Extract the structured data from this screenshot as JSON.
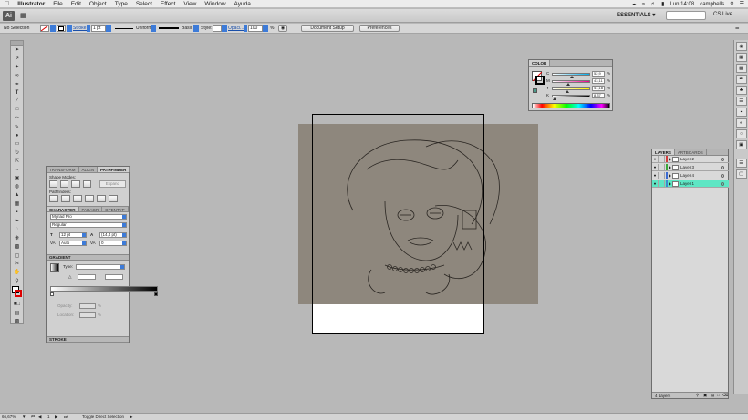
{
  "menubar": {
    "app_name": "Illustrator",
    "menus": [
      "File",
      "Edit",
      "Object",
      "Type",
      "Select",
      "Effect",
      "View",
      "Window",
      "Ayuda"
    ],
    "clock": "Lun 14:08",
    "user": "campbells"
  },
  "appbar": {
    "logo": "Ai",
    "workspace": "ESSENTIALS ▾",
    "cs_live": "CS Live"
  },
  "control": {
    "selection": "No Selection",
    "stroke_label": "Stroke:",
    "stroke_value": "1 pt",
    "profile": "Uniform",
    "brush": "Basic",
    "style_label": "Style:",
    "opacity_label": "Opaci...",
    "opacity_value": "100",
    "percent": "%",
    "doc_setup": "Document Setup",
    "preferences": "Preferences"
  },
  "pathfinder": {
    "tabs": [
      "TRANSFORM",
      "ALIGN",
      "PATHFINDER"
    ],
    "shape_modes": "Shape Modes:",
    "pathfinders": "Pathfinders:",
    "expand": "Expand"
  },
  "character": {
    "tabs": [
      "CHARACTER",
      "PARAGR",
      "OPENTYP"
    ],
    "font": "Myriad Pro",
    "style": "Regular",
    "size": "12 pt",
    "leading": "(14,4 pt)",
    "kerning": "Auto",
    "tracking": "0"
  },
  "gradient": {
    "title": "GRADIENT",
    "type_label": "Type:",
    "opacity_label": "Opacity:",
    "location_label": "Location:",
    "percent": "%"
  },
  "stroke_panel": {
    "title": "STROKE"
  },
  "color": {
    "title": "COLOR",
    "channels": [
      {
        "name": "C",
        "value": "52,9",
        "fill": 0.53
      },
      {
        "name": "M",
        "value": "43,11",
        "fill": 0.43
      },
      {
        "name": "Y",
        "value": "41,18",
        "fill": 0.41
      },
      {
        "name": "K",
        "value": "8,37",
        "fill": 0.08
      }
    ],
    "percent": "%"
  },
  "layers": {
    "tabs": [
      "LAYERS",
      "ARTBOARDS"
    ],
    "items": [
      {
        "name": "Layer 2",
        "color": "#d23a3a",
        "selected": false
      },
      {
        "name": "Layer 3",
        "color": "#3aa83a",
        "selected": false
      },
      {
        "name": "Layer 4",
        "color": "#3a6ad2",
        "selected": false
      },
      {
        "name": "Layer 1",
        "color": "#3a8ad2",
        "selected": true
      }
    ],
    "count": "4 Layers",
    "selected_color": "#5ee6c4"
  },
  "status": {
    "zoom": "66,67%",
    "page": "1",
    "tool": "Toggle Direct Selection"
  }
}
